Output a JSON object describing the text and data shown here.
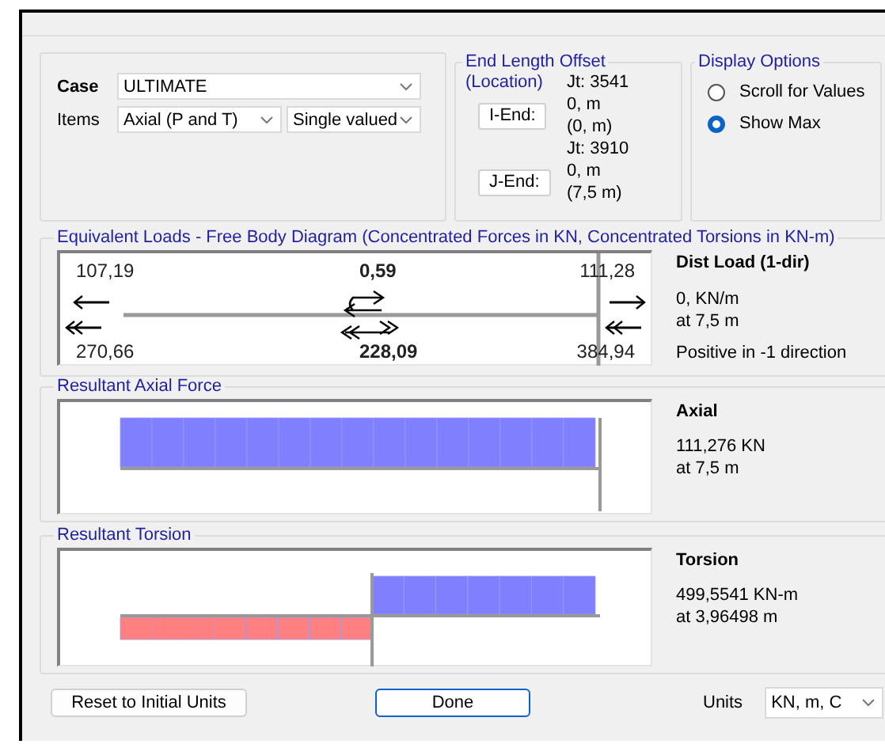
{
  "case": {
    "label": "Case",
    "value": "ULTIMATE"
  },
  "items": {
    "label": "Items",
    "value": "Axial (P and T)",
    "mode": "Single valued"
  },
  "end_length_offset": {
    "title": "End Length Offset",
    "subtitle": "(Location)",
    "ends": [
      {
        "joint": "Jt:  3541",
        "button": "I-End:",
        "offset": "0, m",
        "location": "(0, m)"
      },
      {
        "joint": "Jt:  3910",
        "button": "J-End:",
        "offset": "0, m",
        "location": "(7,5 m)"
      }
    ]
  },
  "display_options": {
    "title": "Display Options",
    "options": [
      {
        "label": "Scroll for Values",
        "selected": false
      },
      {
        "label": "Show Max",
        "selected": true
      }
    ]
  },
  "free_body": {
    "title": "Equivalent Loads - Free Body Diagram  (Concentrated Forces in KN, Concentrated Torsions in KN-m)",
    "top_values": [
      "107,19",
      "0,59",
      "111,28"
    ],
    "bottom_values": [
      "270,66",
      "228,09",
      "384,94"
    ],
    "side": {
      "heading": "Dist Load (1-dir)",
      "value": "0, KN/m",
      "location": "at 7,5 m",
      "note": "Positive in -1 direction"
    }
  },
  "axial": {
    "title": "Resultant Axial Force",
    "heading": "Axial",
    "value": "111,276 KN",
    "location": "at 7,5 m"
  },
  "torsion": {
    "title": "Resultant Torsion",
    "heading": "Torsion",
    "value": "499,5541 KN-m",
    "location": "at 3,96498 m"
  },
  "buttons": {
    "reset": "Reset to Initial Units",
    "done": "Done"
  },
  "units": {
    "label": "Units",
    "value": "KN, m, C"
  }
}
